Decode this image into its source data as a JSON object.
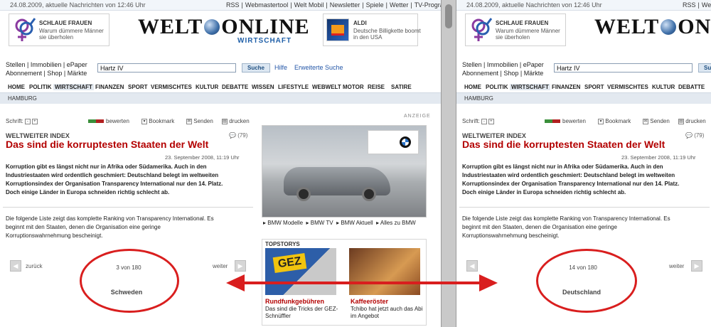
{
  "top_bar": {
    "date": "24.08.2009, aktuelle Nachrichten von 12:46 Uhr",
    "links": [
      "RSS",
      "Webmastertool",
      "Welt Mobil",
      "Newsletter",
      "Spiele",
      "Wetter",
      "TV-Programm"
    ]
  },
  "banner": {
    "ad_left": {
      "title": "SCHLAUE FRAUEN",
      "text": "Warum dümmere Männer sie überholen"
    },
    "logo": {
      "part1": "WELT",
      "part2": "ONLINE",
      "sub": "WIRTSCHAFT"
    },
    "ad_right": {
      "title": "ALDI",
      "text": "Deutsche Billigkette boomt in den USA"
    }
  },
  "services": {
    "line1": "Stellen | Immobilien | ePaper",
    "line2": "Abonnement | Shop | Märkte"
  },
  "search": {
    "value": "Hartz IV",
    "button": "Suche",
    "help": "Hilfe",
    "advanced": "Erweiterte Suche"
  },
  "nav": [
    "HOME",
    "POLITIK",
    "WIRTSCHAFT",
    "FINANZEN",
    "SPORT",
    "VERMISCHTES",
    "KULTUR",
    "DEBATTE",
    "WISSEN",
    "LIFESTYLE",
    "WEBWELT",
    "MOTOR",
    "REISE",
    "SATIRE"
  ],
  "nav_active": "WIRTSCHAFT",
  "subnav": "HAMBURG",
  "toolbar": {
    "schrift": "Schrift:",
    "rate": "bewerten",
    "bookmark": "Bookmark",
    "send": "Senden",
    "print": "drucken"
  },
  "article": {
    "kicker": "WELTWEITER INDEX",
    "comments": "(79)",
    "headline": "Das sind die korruptesten Staaten der Welt",
    "dateline": "23. September 2008, 11:19 Uhr",
    "teaser": [
      "Korruption gibt es längst nicht nur in Afrika oder Südamerika. Auch in den",
      "Industriestaaten wird ordentlich geschmiert: Deutschland belegt im weltweiten",
      "Korruptionsindex der Organisation Transparency International nur den 14. Platz.",
      "Doch einige Länder in Europa schneiden richtig schlecht ab."
    ],
    "body": [
      "Die folgende Liste zeigt das komplette Ranking von Transparency International. Es",
      "beginnt mit den Staaten, denen die Organisation eine geringe",
      "Korruptionswahrnehmung bescheinigt."
    ]
  },
  "gallery_left": {
    "back": "zurück",
    "next": "weiter",
    "counter": "3 von 180",
    "country": "Schweden"
  },
  "gallery_right": {
    "next": "weiter",
    "counter": "14 von 180",
    "country": "Deutschland"
  },
  "sidebar": {
    "anzeige": "ANZEIGE",
    "ad_links": [
      "BMW Modelle",
      "BMW TV",
      "BMW Aktuell",
      "Alles zu BMW"
    ],
    "topstorys": {
      "header": "TOPSTORYS",
      "items": [
        {
          "title": "Rundfunkgebühren",
          "text": "Das sind die Tricks der GEZ-Schnüffler",
          "thumb_text": "GEZ"
        },
        {
          "title": "Kaffeeröster",
          "text": "Tchibo hat jetzt auch das Abi im Angebot",
          "thumb_text": ""
        }
      ]
    }
  },
  "colors": {
    "accent_red": "#b30000",
    "annotation_red": "#d91e1e",
    "link_blue": "#2457a8"
  }
}
